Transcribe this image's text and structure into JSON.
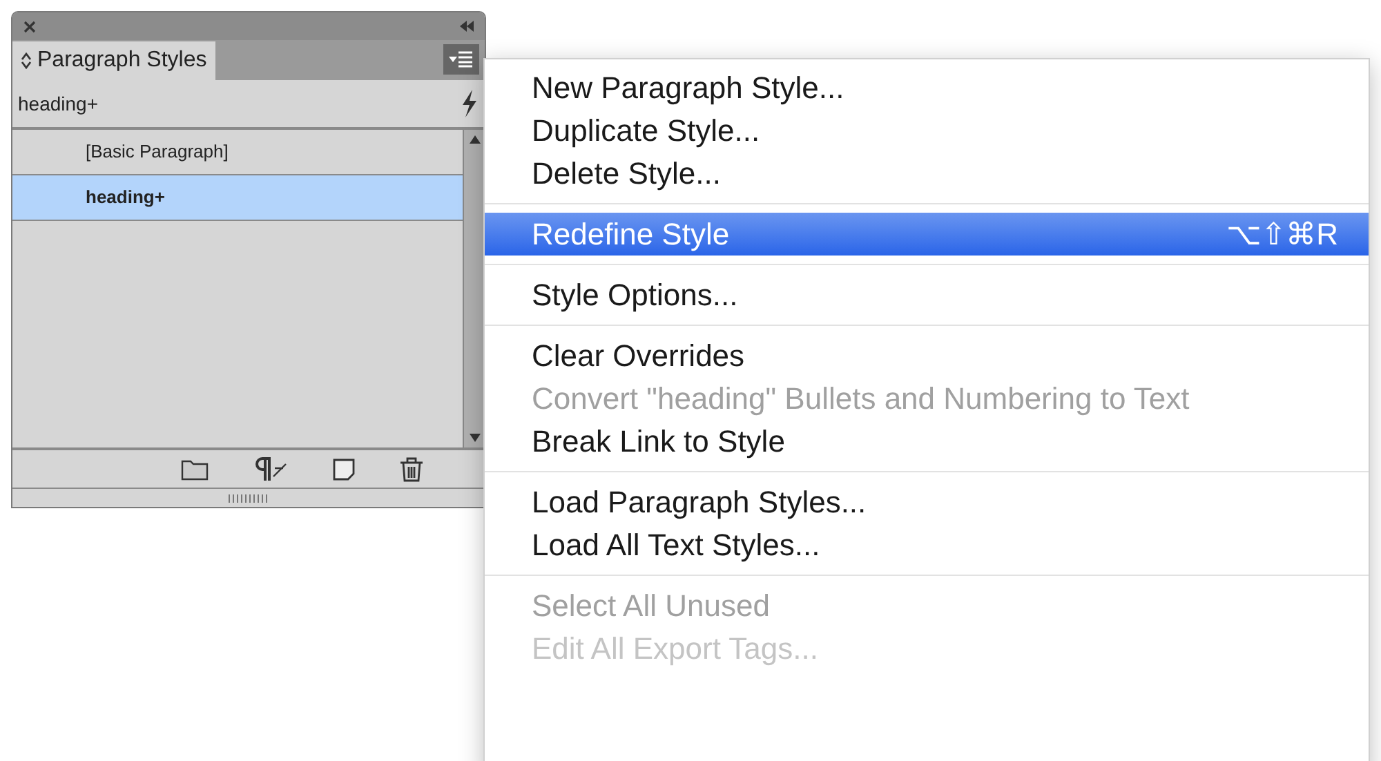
{
  "panel": {
    "tab": "Paragraph Styles",
    "current_style": "heading+",
    "styles": [
      {
        "label": "[Basic Paragraph]",
        "selected": false
      },
      {
        "label": "heading+",
        "selected": true
      }
    ]
  },
  "menu": {
    "groups": [
      [
        {
          "label": "New Paragraph Style...",
          "selected": false,
          "disabled": false
        },
        {
          "label": "Duplicate Style...",
          "selected": false,
          "disabled": false
        },
        {
          "label": "Delete Style...",
          "selected": false,
          "disabled": false
        }
      ],
      [
        {
          "label": "Redefine Style",
          "shortcut": "⌥⇧⌘R",
          "selected": true,
          "disabled": false
        }
      ],
      [
        {
          "label": "Style Options...",
          "selected": false,
          "disabled": false
        }
      ],
      [
        {
          "label": "Clear Overrides",
          "selected": false,
          "disabled": false
        },
        {
          "label": "Convert \"heading\" Bullets and Numbering to Text",
          "selected": false,
          "disabled": true
        },
        {
          "label": "Break Link to Style",
          "selected": false,
          "disabled": false
        }
      ],
      [
        {
          "label": "Load Paragraph Styles...",
          "selected": false,
          "disabled": false
        },
        {
          "label": "Load All Text Styles...",
          "selected": false,
          "disabled": false
        }
      ],
      [
        {
          "label": "Select All Unused",
          "selected": false,
          "disabled": true
        },
        {
          "label": "Edit All Export Tags...",
          "selected": false,
          "disabled": true
        }
      ]
    ]
  }
}
